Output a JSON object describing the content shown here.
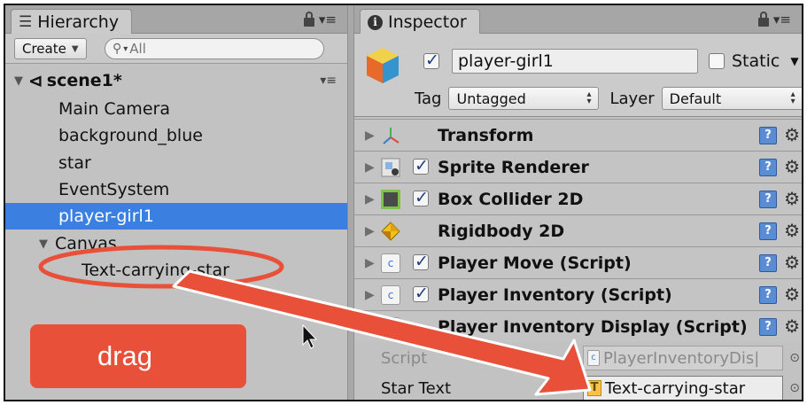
{
  "hierarchy": {
    "tab_label": "Hierarchy",
    "tab_icon": "list-icon",
    "create_label": "Create",
    "search_placeholder": "All",
    "scene_name": "scene1*",
    "items": [
      {
        "label": "Main Camera"
      },
      {
        "label": "background_blue"
      },
      {
        "label": "star"
      },
      {
        "label": "EventSystem"
      },
      {
        "label": "player-girl1",
        "selected": true
      },
      {
        "label": "Canvas",
        "expanded": true
      },
      {
        "label": "Text-carrying-star",
        "child_of": "Canvas"
      }
    ]
  },
  "inspector": {
    "tab_label": "Inspector",
    "gameobject": {
      "active": true,
      "name": "player-girl1",
      "static_label": "Static",
      "static_checked": false,
      "tag_label": "Tag",
      "tag_value": "Untagged",
      "layer_label": "Layer",
      "layer_value": "Default"
    },
    "components": [
      {
        "label": "Transform",
        "has_checkbox": false,
        "icon": "transform-axes-icon"
      },
      {
        "label": "Sprite Renderer",
        "has_checkbox": true,
        "checked": true,
        "icon": "sprite-renderer-icon"
      },
      {
        "label": "Box Collider 2D",
        "has_checkbox": true,
        "checked": true,
        "icon": "box-collider-icon"
      },
      {
        "label": "Rigidbody 2D",
        "has_checkbox": false,
        "icon": "rigidbody-icon"
      },
      {
        "label": "Player Move (Script)",
        "has_checkbox": true,
        "checked": true,
        "icon": "script-icon"
      },
      {
        "label": "Player Inventory (Script)",
        "has_checkbox": true,
        "checked": true,
        "icon": "script-icon"
      },
      {
        "label": "Player Inventory Display (Script)",
        "has_checkbox": false,
        "expanded": true,
        "icon": "script-icon"
      }
    ],
    "script_field": {
      "label": "Script",
      "value": "PlayerInventoryDis|"
    },
    "star_text_field": {
      "label": "Star Text",
      "value": "Text-carrying-star"
    }
  },
  "annotation": {
    "callout_text": "drag",
    "accent": "#e8503a"
  }
}
